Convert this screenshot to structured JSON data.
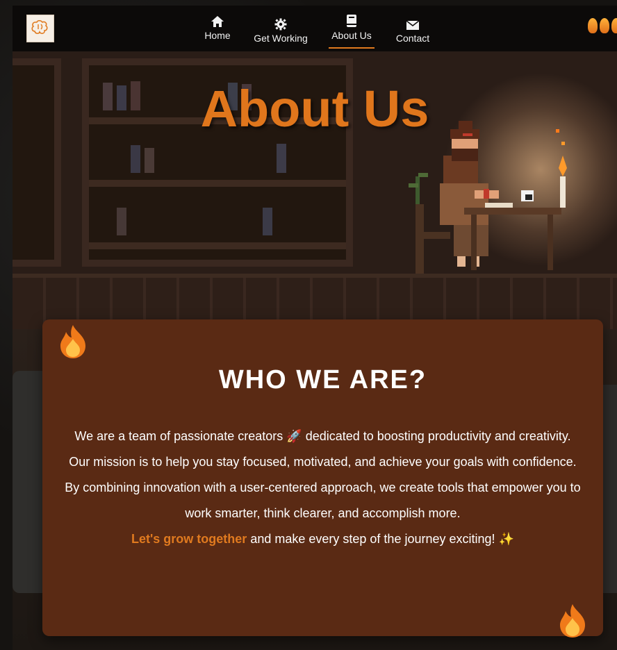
{
  "nav": {
    "items": [
      {
        "label": "Home",
        "icon": "home-icon"
      },
      {
        "label": "Get Working",
        "icon": "gear-icon"
      },
      {
        "label": "About Us",
        "icon": "book-icon",
        "active": true
      },
      {
        "label": "Contact",
        "icon": "envelope-icon"
      }
    ]
  },
  "hero": {
    "title": "About Us"
  },
  "card": {
    "title": "WHO WE ARE?",
    "p1_before": "We are a team of passionate creators",
    "p1_emoji": "🚀",
    "p1_after": "dedicated to boosting productivity and creativity. Our mission is to help you stay focused, motivated, and achieve your goals with confidence.",
    "p2": "By combining innovation with a user-centered approach, we create tools that empower you to work smarter, think clearer, and accomplish more.",
    "p3_highlight": "Let's grow together",
    "p3_after": "and make every step of the journey exciting!",
    "p3_emoji": "✨"
  },
  "colors": {
    "accent": "#e07a1f",
    "card_bg": "#5a2a14",
    "nav_bg": "#0c0a09"
  }
}
